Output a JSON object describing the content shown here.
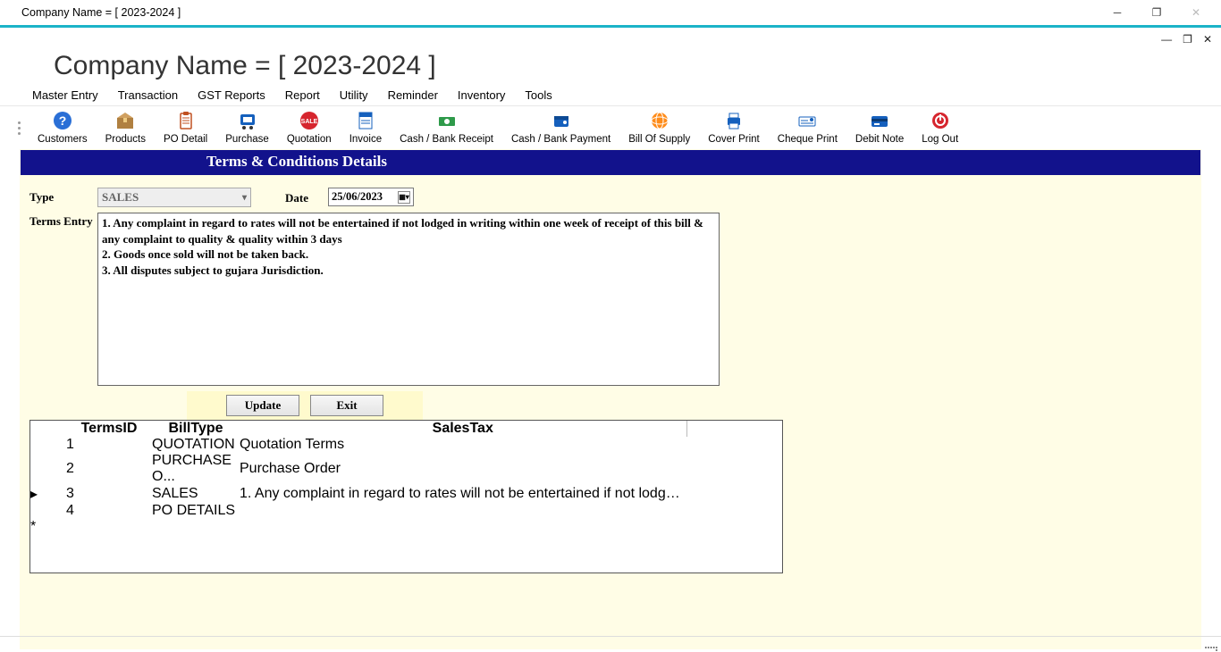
{
  "outer_window": {
    "title": "Company Name    =    [   2023-2024   ]"
  },
  "inner_header": "Company Name    =    [   2023-2024   ]",
  "menu": {
    "items": [
      "Master Entry",
      "Transaction",
      "GST Reports",
      "Report",
      "Utility",
      "Reminder",
      "Inventory",
      "Tools"
    ]
  },
  "ribbon": [
    {
      "label": "Customers",
      "icon": "help-blue"
    },
    {
      "label": "Products",
      "icon": "box"
    },
    {
      "label": "PO Detail",
      "icon": "clipboard"
    },
    {
      "label": "Purchase",
      "icon": "cart-blue"
    },
    {
      "label": "Quotation",
      "icon": "sale-red"
    },
    {
      "label": "Invoice",
      "icon": "doc-blue"
    },
    {
      "label": "Cash / Bank Receipt",
      "icon": "money"
    },
    {
      "label": "Cash / Bank Payment",
      "icon": "wallet"
    },
    {
      "label": "Bill Of Supply",
      "icon": "globe"
    },
    {
      "label": "Cover Print",
      "icon": "printer"
    },
    {
      "label": "Cheque Print",
      "icon": "cheque"
    },
    {
      "label": "Debit Note",
      "icon": "card"
    },
    {
      "label": "Log Out",
      "icon": "power"
    }
  ],
  "page": {
    "banner": "Terms & Conditions Details",
    "type_label": "Type",
    "type_value": "SALES",
    "date_label": "Date",
    "date_value": "25/06/2023",
    "terms_label": "Terms Entry",
    "terms_text": "1. Any complaint in regard to rates will not be entertained if not lodged in writing within one week of receipt of this bill & any complaint to quality & quality within 3 days\n2. Goods once sold will not be taken back.\n3. All disputes subject to gujara Jurisdiction.",
    "update_btn": "Update",
    "exit_btn": "Exit"
  },
  "grid": {
    "headers": [
      "TermsID",
      "BillType",
      "SalesTax"
    ],
    "col_widths": [
      "96px",
      "98px",
      "500px"
    ],
    "rows": [
      {
        "indicator": "",
        "cells": [
          "1",
          "QUOTATION",
          "Quotation Terms"
        ],
        "selected": false
      },
      {
        "indicator": "",
        "cells": [
          "2",
          "PURCHASE O...",
          "Purchase Order"
        ],
        "selected": false
      },
      {
        "indicator": "▸",
        "cells": [
          "3",
          "SALES",
          "1. Any complaint in regard to rates will not be entertained if not lodged in writing within o..."
        ],
        "selected": true
      },
      {
        "indicator": "",
        "cells": [
          "4",
          "PO DETAILS",
          ""
        ],
        "selected": false
      },
      {
        "indicator": "*",
        "cells": [
          "",
          "",
          ""
        ],
        "selected": false
      }
    ]
  }
}
